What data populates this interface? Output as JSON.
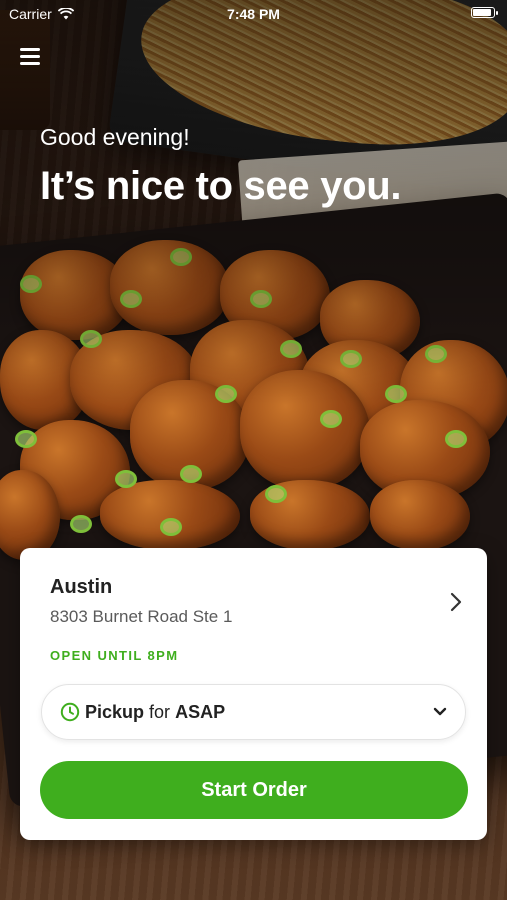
{
  "status_bar": {
    "carrier": "Carrier",
    "time": "7:48 PM"
  },
  "header": {
    "menu_icon": "hamburger-menu-icon",
    "greeting": "Good evening!",
    "headline": "It’s nice to see you."
  },
  "location": {
    "name": "Austin",
    "address": "8303 Burnet Road Ste 1",
    "hours": "OPEN UNTIL 8PM",
    "chevron_icon": "chevron-right-icon"
  },
  "order_type": {
    "icon": "clock-icon",
    "mode": "Pickup",
    "connector": "for",
    "time": "ASAP",
    "dropdown_icon": "chevron-down-icon"
  },
  "actions": {
    "start_order_label": "Start Order"
  },
  "colors": {
    "accent_green": "#3fae1e",
    "card_bg": "#ffffff",
    "text_dark": "#222222"
  }
}
